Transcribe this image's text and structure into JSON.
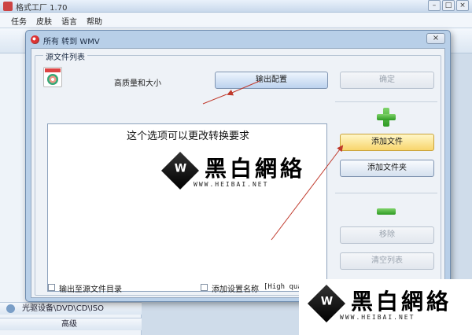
{
  "app": {
    "title": "格式工厂 1.70",
    "menu": [
      "任务",
      "皮肤",
      "语言",
      "帮助"
    ],
    "left_rows": [
      "光驱设备\\DVD\\CD\\ISO",
      "高级"
    ]
  },
  "dialog": {
    "title": "所有 转到 WMV",
    "close_label": "×",
    "group_label": "源文件列表",
    "quality_label": "高质量和大小",
    "output_config_button": "输出配置",
    "ok_button": "确定",
    "annotation": "这个选项可以更改转换要求",
    "add_file_button": "添加文件",
    "add_folder_button": "添加文件夹",
    "remove_button": "移除",
    "clear_list_button": "清空列表",
    "output_to_source_label": "输出至源文件目录",
    "add_setting_name_label": "添加设置名称",
    "add_setting_name_value": "[High quality and size]"
  },
  "watermark": {
    "logo_text": "黑白網絡",
    "url": "WWW.HEIBAI.NET"
  },
  "colors": {
    "accent_green": "#2d9a23",
    "highlight": "#f8d56c",
    "arrow_red": "#c0392b"
  }
}
